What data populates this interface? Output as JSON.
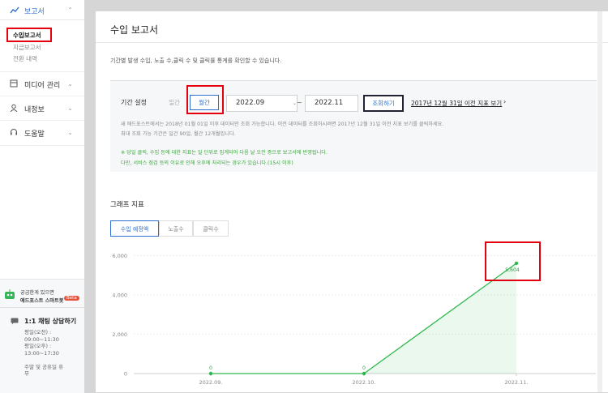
{
  "sidebar": {
    "report_label": "보고서",
    "sub_items": [
      "수입보고서",
      "지급보고서",
      "전환 내역"
    ],
    "menus": [
      {
        "icon": "media-icon",
        "label": "미디어 관리"
      },
      {
        "icon": "user-icon",
        "label": "내정보"
      },
      {
        "icon": "headset-icon",
        "label": "도움말"
      }
    ],
    "smartbot": {
      "line1": "궁금한게 있으면",
      "line2": "애드포스트 스마트봇",
      "badge": "Beta"
    },
    "chat": {
      "title": "1:1 채팅 상담하기",
      "hours": [
        "평일(오전) :",
        "09:00~11:30",
        "평일(오후) :",
        "13:00~17:30",
        "",
        "주말 및 공휴일 휴",
        "무"
      ]
    }
  },
  "page": {
    "title": "수입 보고서",
    "description": "기간별 발생 수입, 노출 수,클릭 수 및 클릭률 통계를 확인할 수 있습니다."
  },
  "period": {
    "label": "기간 설정",
    "daily": "일간",
    "monthly": "월간",
    "start": "2022.09",
    "separator": "~",
    "end": "2022.11",
    "search": "조회하기",
    "old_link": "2017년 12월 31일 이전 지표 보기",
    "notes": [
      "새 애드포스트에서는 2018년 01월 01일 이후 데이터만 조회 가능합니다. 이전 데이터를 조회하시려면 2017년 12월 31일 이전 지표 보기를 클릭하세요.",
      "최대 조회 가능 기간은 일간 90일, 월간 12개월입니다."
    ],
    "green_notes": [
      "※ 당일 클릭, 수입 등에 대한 지표는 일 단위로 집계되어 다음 날 오전 중으로 보고서에 반영됩니다.",
      "다만, 서비스 점검 등의 이유로 인해 오후에 처리되는 경우가 있습니다.(15시 이후)"
    ]
  },
  "graph": {
    "title": "그래프 지표",
    "tabs": [
      "수입 예정액",
      "노출수",
      "클릭수"
    ]
  },
  "chart_data": {
    "type": "line",
    "categories": [
      "2022.09.",
      "2022.10.",
      "2022.11."
    ],
    "values": [
      0,
      0,
      5604
    ],
    "value_labels": [
      "0",
      "0",
      "5,604"
    ],
    "y_ticks": [
      0,
      2000,
      4000,
      6000
    ],
    "y_tick_labels": [
      "0",
      "2,000",
      "4,000",
      "6,000"
    ],
    "ylim": [
      0,
      6300
    ],
    "color": "#2db84d"
  }
}
